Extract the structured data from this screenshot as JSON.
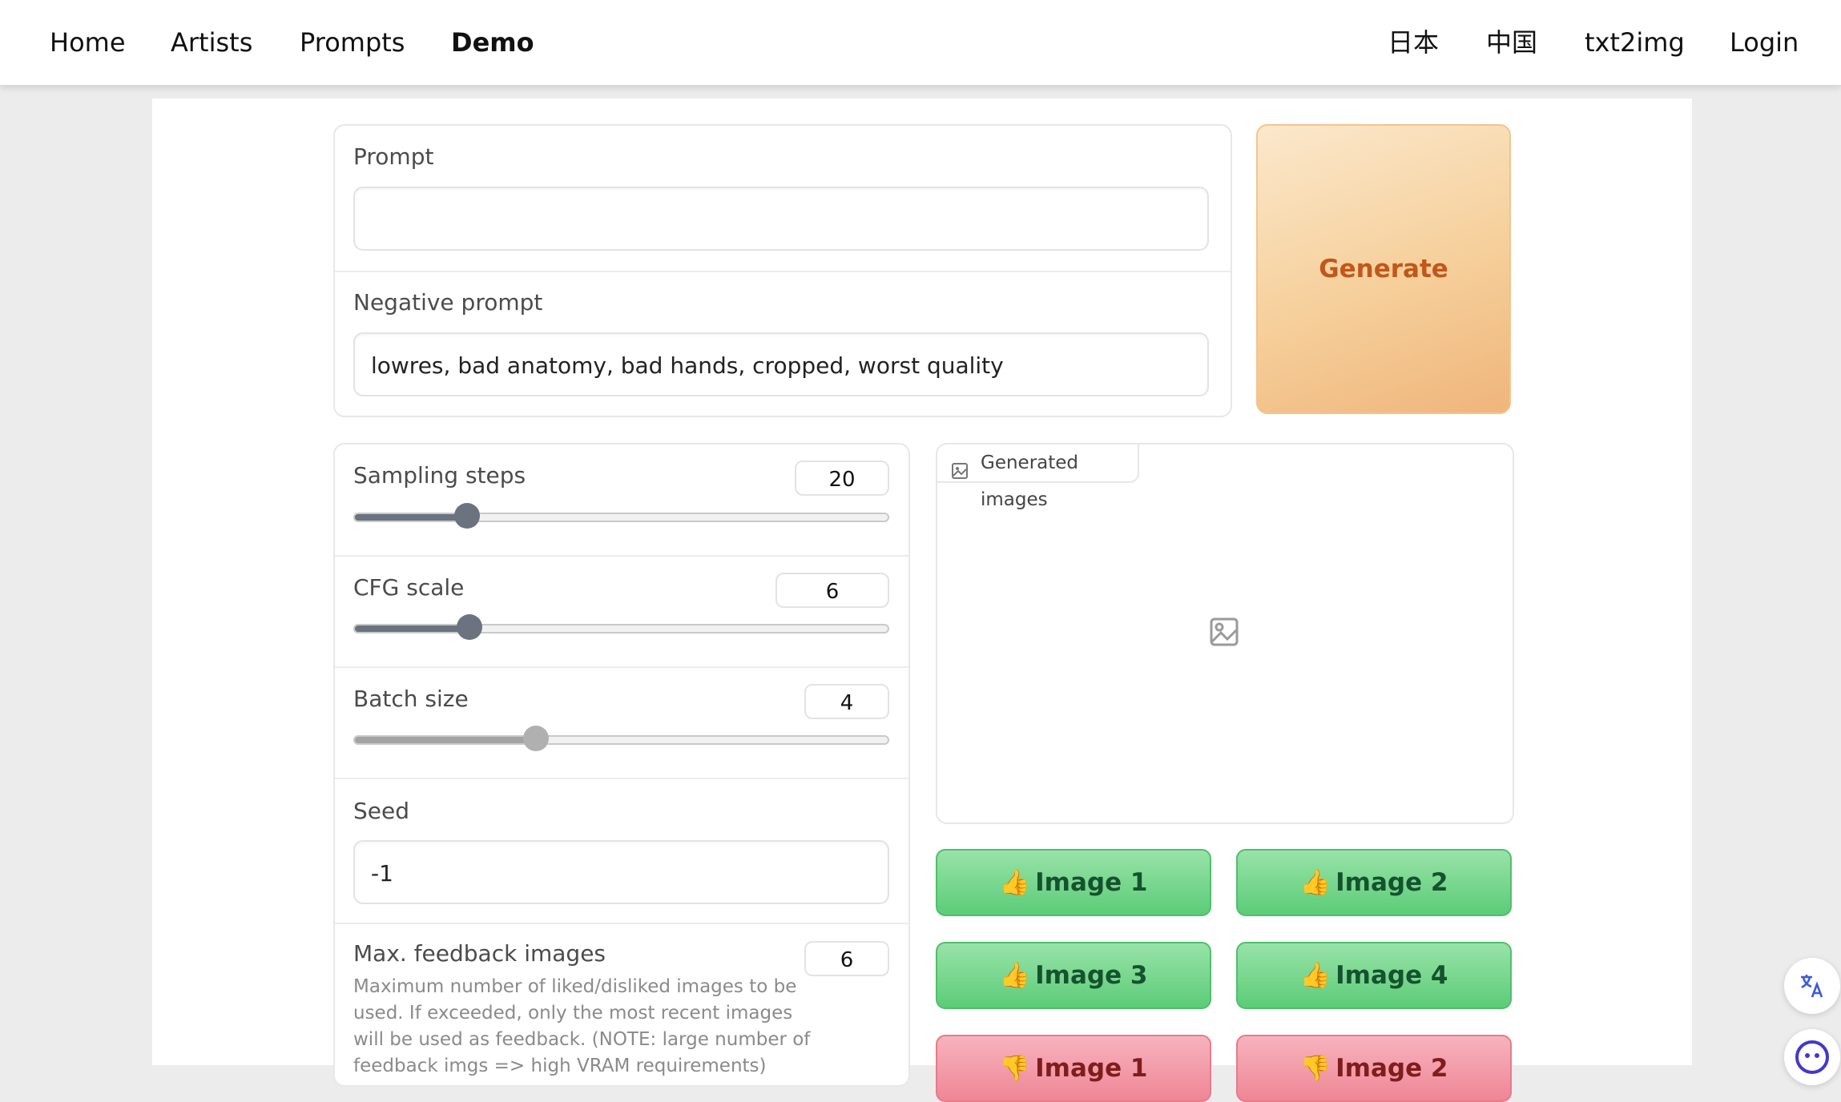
{
  "nav": {
    "left": [
      "Home",
      "Artists",
      "Prompts",
      "Demo"
    ],
    "active": "Demo",
    "right": [
      "日本",
      "中国",
      "txt2img",
      "Login"
    ]
  },
  "prompt": {
    "label": "Prompt",
    "value": ""
  },
  "negative_prompt": {
    "label": "Negative prompt",
    "value": "lowres, bad anatomy, bad hands, cropped, worst quality"
  },
  "generate": {
    "label": "Generate"
  },
  "sliders": {
    "sampling_steps": {
      "label": "Sampling steps",
      "value": "20",
      "fraction": 0.21
    },
    "cfg_scale": {
      "label": "CFG scale",
      "value": "6",
      "fraction": 0.215
    },
    "batch_size": {
      "label": "Batch size",
      "value": "4",
      "fraction": 0.34
    }
  },
  "seed": {
    "label": "Seed",
    "value": "-1"
  },
  "max_feedback": {
    "label": "Max. feedback images",
    "value": "6",
    "description": "Maximum number of liked/disliked images to be used. If exceeded, only the most recent images will be used as feedback. (NOTE: large number of feedback imgs => high VRAM requirements)"
  },
  "gallery": {
    "label": "Generated images",
    "icon": "image-icon"
  },
  "like_buttons": [
    "Image 1",
    "Image 2",
    "Image 3",
    "Image 4"
  ],
  "dislike_buttons": [
    "Image 1",
    "Image 2"
  ],
  "emoji": {
    "like": "👍",
    "dislike": "👎"
  },
  "colors": {
    "accent": "#c2571a",
    "like": "#5ccc78",
    "dislike": "#ef8696"
  }
}
